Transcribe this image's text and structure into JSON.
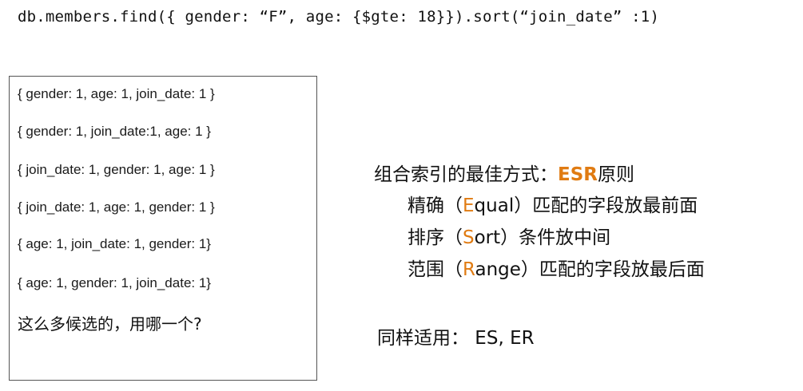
{
  "query": "db.members.find({ gender: “F”,  age: {$gte: 18}}).sort(“join_date” :1)",
  "candidates": [
    "{ gender: 1, age: 1, join_date: 1 }",
    "{ gender: 1, join_date:1, age: 1 }",
    "{ join_date: 1, gender: 1, age: 1 }",
    "{ join_date: 1, age: 1, gender: 1 }",
    "{ age: 1, join_date: 1, gender: 1}",
    "{ age: 1, gender: 1, join_date: 1}"
  ],
  "question": "这么多候选的，用哪一个?",
  "rule": {
    "title_prefix": "组合索引的最佳方式：",
    "title_accent": "ESR",
    "title_suffix": "原则",
    "items": [
      {
        "before": "精确（",
        "accent": "E",
        "after": "qual）匹配的字段放最前面"
      },
      {
        "before": "排序（",
        "accent": "S",
        "after": "ort）条件放中间"
      },
      {
        "before": "范围（",
        "accent": "R",
        "after": "ange）匹配的字段放最后面"
      }
    ]
  },
  "applies": "同样适用： ES, ER",
  "colors": {
    "accent": "#e07b12",
    "text": "#111111",
    "border": "#555555"
  }
}
